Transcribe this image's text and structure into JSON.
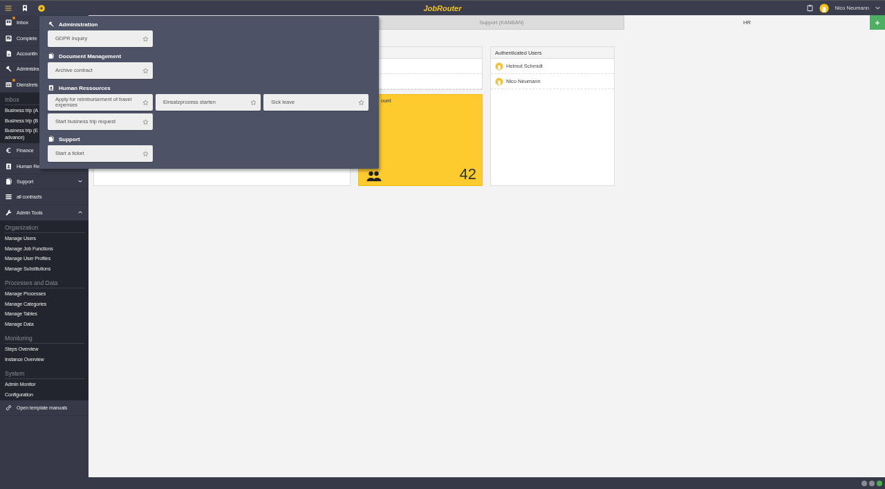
{
  "top_bar": {
    "logo": "JobRouter",
    "user": "Nico Neumann"
  },
  "sidebar": {
    "items": [
      {
        "label": "Inbox",
        "notification": true
      },
      {
        "label": "Complete",
        "notification": false
      },
      {
        "label": "Accountin",
        "notification": false
      },
      {
        "label": "Administra",
        "notification": false
      },
      {
        "label": "Dienstreis",
        "notification": true,
        "sections": [
          {
            "title": "Inbox",
            "links": [
              "Business trip (A",
              "Business trip (B",
              "Business trip (E\nadvance)"
            ]
          }
        ]
      },
      {
        "label": "Finance",
        "notification": false
      },
      {
        "label": "Human Re",
        "notification": false
      },
      {
        "label": "Support",
        "notification": false,
        "expanded": false
      },
      {
        "label": "all contracts",
        "notification": false
      },
      {
        "label": "Admin Tools",
        "notification": false,
        "expanded": true,
        "sections": [
          {
            "title": "Organization",
            "links": [
              "Manage Users",
              "Manage Job Functions",
              "Manage User Profiles",
              "Manage Substitutions"
            ]
          },
          {
            "title": "Processes and Data",
            "links": [
              "Manage Processes",
              "Manage Categories",
              "Manage Tables",
              "Manage Data"
            ]
          },
          {
            "title": "Monitoring",
            "links": [
              "Steps Overview",
              "Instance Overview"
            ]
          },
          {
            "title": "System",
            "links": [
              "Admin Monitor",
              "Configuration"
            ]
          }
        ]
      },
      {
        "label": "Open template manuals",
        "notification": false
      }
    ]
  },
  "tabs": [
    {
      "label": "Support (KANBAN)",
      "selected": false
    },
    {
      "label": "HR",
      "selected": true
    }
  ],
  "widgets": {
    "counter": {
      "title": "ount",
      "value": "42"
    },
    "authenticated_users": {
      "title": "Authenticated Users",
      "users": [
        "Helmut Schmidt",
        "Nico Neumann"
      ]
    }
  },
  "start_menu": {
    "groups": [
      {
        "title": "Administration",
        "cards": [
          "GDPR Inquiry"
        ]
      },
      {
        "title": "Document Management",
        "cards": [
          "Archive contract"
        ]
      },
      {
        "title": "Human Ressources",
        "cards": [
          "Apply for reimbursement of travel expenses",
          "Einsatzprozess starten",
          "Sick leave",
          "Start business trip request"
        ]
      },
      {
        "title": "Support",
        "cards": [
          "Start a ticket"
        ]
      }
    ]
  },
  "status_bar": {
    "indicators": [
      {
        "color": "#8a8c93"
      },
      {
        "color": "#8a8c93"
      },
      {
        "color": "#4caf50"
      }
    ]
  }
}
